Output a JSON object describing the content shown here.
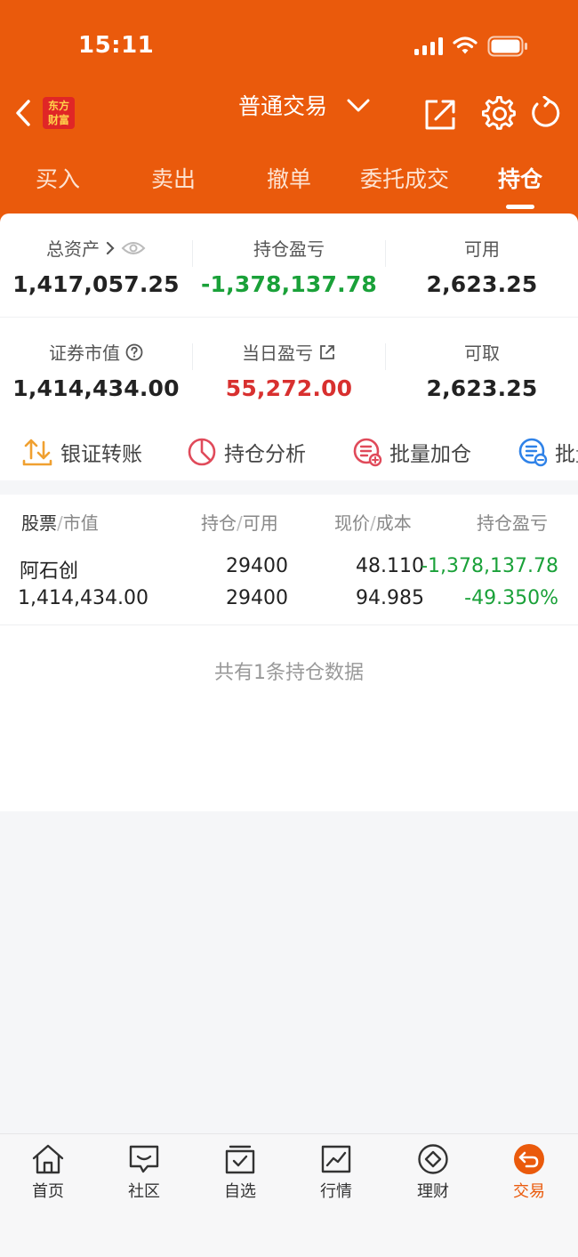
{
  "status": {
    "time": "15:11"
  },
  "nav": {
    "title": "普通交易",
    "logo_line1": "东方",
    "logo_line2": "财富"
  },
  "tabs": [
    {
      "label": "买入"
    },
    {
      "label": "卖出"
    },
    {
      "label": "撤单"
    },
    {
      "label": "委托成交"
    },
    {
      "label": "持仓",
      "active": true
    }
  ],
  "summary": {
    "total_assets_label": "总资产",
    "total_assets_value": "1,417,057.25",
    "position_pnl_label": "持仓盈亏",
    "position_pnl_value": "-1,378,137.78",
    "available_label": "可用",
    "available_value": "2,623.25",
    "market_value_label": "证券市值",
    "market_value_value": "1,414,434.00",
    "daily_pnl_label": "当日盈亏",
    "daily_pnl_value": "55,272.00",
    "withdrawable_label": "可取",
    "withdrawable_value": "2,623.25"
  },
  "quick_actions": [
    {
      "label": "银证转账",
      "icon": "transfer-icon"
    },
    {
      "label": "持仓分析",
      "icon": "pie-chart-icon"
    },
    {
      "label": "批量加仓",
      "icon": "batch-add-icon"
    },
    {
      "label": "批量",
      "icon": "batch-icon"
    }
  ],
  "holdings_header": {
    "col1_main": "股票",
    "col1_sub": "市值",
    "col2_main": "持仓",
    "col2_sub": "可用",
    "col3_main": "现价",
    "col3_sub": "成本",
    "col4": "持仓盈亏"
  },
  "holdings": [
    {
      "name": "阿石创",
      "market_value": "1,414,434.00",
      "position": "29400",
      "available": "29400",
      "price": "48.110",
      "cost": "94.985",
      "pnl": "-1,378,137.78",
      "pnl_pct": "-49.350%"
    }
  ],
  "holdings_summary": "共有1条持仓数据",
  "bottom_nav": [
    {
      "label": "首页",
      "icon": "home-icon"
    },
    {
      "label": "社区",
      "icon": "community-icon"
    },
    {
      "label": "自选",
      "icon": "watchlist-icon"
    },
    {
      "label": "行情",
      "icon": "market-icon"
    },
    {
      "label": "理财",
      "icon": "wealth-icon"
    },
    {
      "label": "交易",
      "icon": "trade-icon",
      "active": true
    }
  ],
  "colors": {
    "brand": "#ea5a0c",
    "gain": "#d8302f",
    "loss": "#1aa139"
  }
}
